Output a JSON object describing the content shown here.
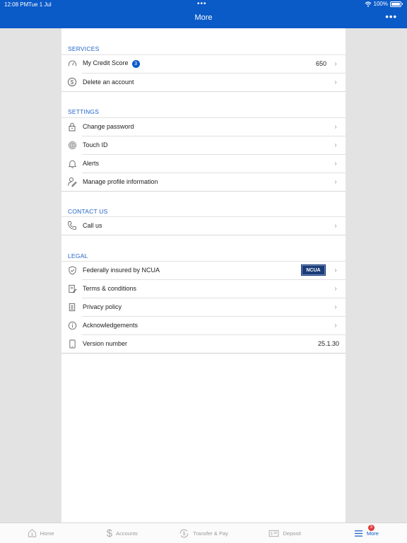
{
  "status_bar": {
    "time": "12:08 PM",
    "date": "Tue 1 Jul",
    "battery": "100%"
  },
  "header": {
    "title": "More"
  },
  "services": {
    "title": "SERVICES",
    "credit_score": {
      "label": "My Credit Score",
      "badge": "3",
      "value": "650"
    },
    "delete_account": {
      "label": "Delete an account"
    }
  },
  "settings": {
    "title": "SETTINGS",
    "items": [
      {
        "label": "Change password",
        "icon": "lock-icon"
      },
      {
        "label": "Touch ID",
        "icon": "fingerprint-icon"
      },
      {
        "label": "Alerts",
        "icon": "bell-icon"
      },
      {
        "label": "Manage profile information",
        "icon": "profile-edit-icon"
      }
    ]
  },
  "contact": {
    "title": "CONTACT US",
    "call": {
      "label": "Call us"
    }
  },
  "legal": {
    "title": "LEGAL",
    "ncua": {
      "label": "Federally insured by NCUA",
      "logo_text": "NCUA"
    },
    "terms": {
      "label": "Terms & conditions"
    },
    "privacy": {
      "label": "Privacy policy"
    },
    "ack": {
      "label": "Acknowledgements"
    },
    "version": {
      "label": "Version number",
      "value": "25.1.30"
    }
  },
  "tabs": [
    {
      "label": "Home",
      "icon": "home-icon"
    },
    {
      "label": "Accounts",
      "icon": "dollar-icon"
    },
    {
      "label": "Transfer & Pay",
      "icon": "transfer-icon"
    },
    {
      "label": "Deposit",
      "icon": "check-deposit-icon"
    },
    {
      "label": "More",
      "icon": "menu-icon",
      "badge": "3",
      "active": true
    }
  ],
  "colors": {
    "brand": "#0a5ac8",
    "section_title": "#1f63c9",
    "badge_alert": "#e13838"
  }
}
